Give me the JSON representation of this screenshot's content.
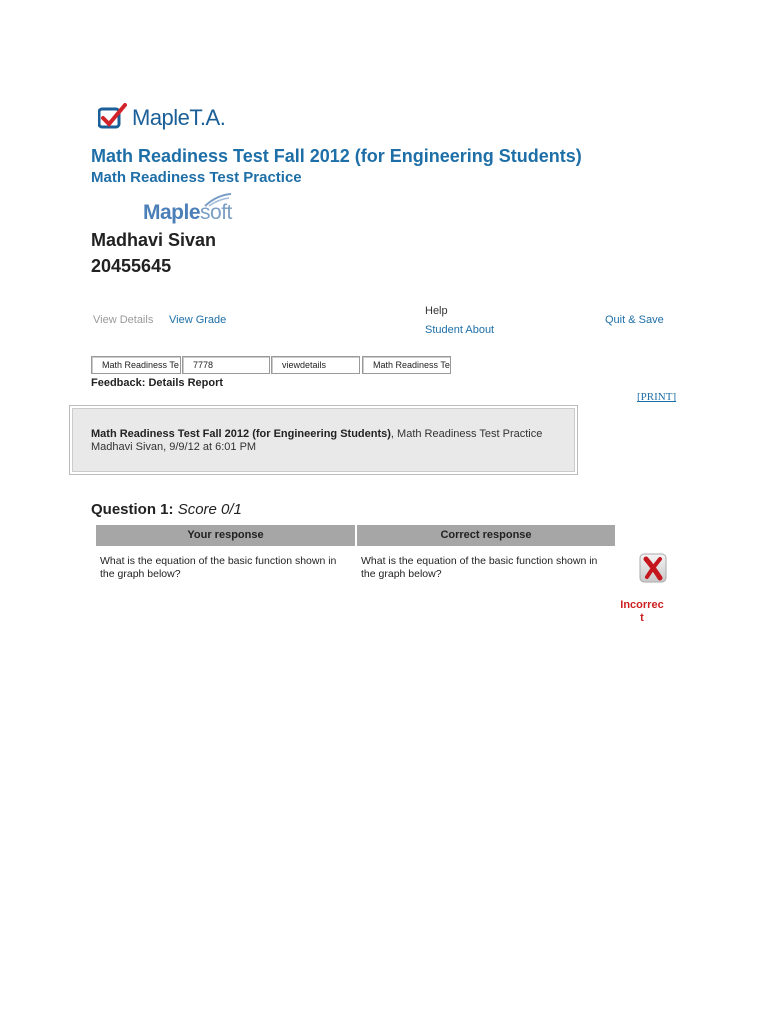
{
  "header": {
    "logo_text": "MapleT.A.",
    "main_title": "Math Readiness Test Fall 2012 (for Engineering Students)",
    "sub_title": "Math Readiness Test Practice",
    "brand_logo_text": "Maplesoft",
    "brand_logo_part1": "Maple",
    "brand_logo_part2": "soft"
  },
  "student": {
    "name": "Madhavi Sivan",
    "id": "20455645"
  },
  "nav": {
    "view_details": "View Details",
    "view_grade": "View Grade",
    "help": "Help",
    "student_about": "Student About",
    "quit_save": "Quit & Save"
  },
  "fields": [
    "Math Readiness Te",
    "7778",
    "viewdetails",
    "Math Readiness Te"
  ],
  "feedback": {
    "title": "Feedback: Details Report",
    "print": "[PRINT]",
    "info_bold": "Math Readiness Test Fall 2012 (for Engineering Students)",
    "info_rest": ", Math Readiness Test Practice",
    "info_line2": "Madhavi Sivan, 9/9/12 at 6:01 PM"
  },
  "question": {
    "label": "Question 1:",
    "score": "Score 0/1",
    "col_your": "Your response",
    "col_correct": "Correct response",
    "your_response": "What is the equation of the basic function shown in the graph below?",
    "correct_response": "What is the equation of the basic function shown in the graph below?",
    "status": "Incorrect",
    "status_icon": "x-mark-icon"
  },
  "colors": {
    "link": "#1e6fa8",
    "header_bg": "#a6a6a6",
    "incorrect": "#cc1f1f"
  }
}
